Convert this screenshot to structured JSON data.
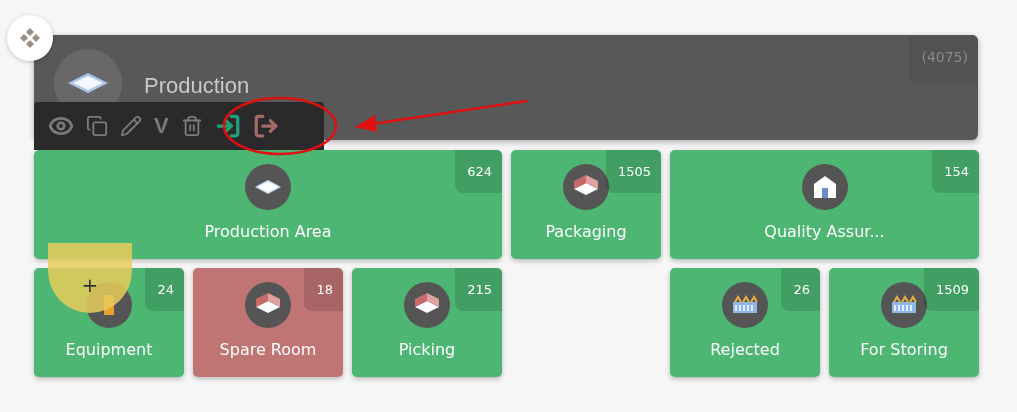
{
  "header": {
    "title": "Production",
    "count": "(4075)"
  },
  "toolbar": {
    "version_label": "V"
  },
  "add_button": {
    "label": "+"
  },
  "tiles": [
    {
      "name": "Production Area",
      "count": "624",
      "kind": "layer",
      "color": "#4cb672"
    },
    {
      "name": "Packaging",
      "count": "1505",
      "kind": "room",
      "color": "#4cb672"
    },
    {
      "name": "Quality Assur...",
      "count": "154",
      "kind": "building",
      "color": "#4cb672"
    },
    {
      "name": "Equipment",
      "count": "24",
      "kind": "equipment",
      "color": "#4cb672"
    },
    {
      "name": "Spare Room",
      "count": "18",
      "kind": "room",
      "color": "#c07474"
    },
    {
      "name": "Picking",
      "count": "215",
      "kind": "room",
      "color": "#4cb672"
    },
    {
      "name": "Rejected",
      "count": "26",
      "kind": "factory",
      "color": "#4cb672"
    },
    {
      "name": "For Storing",
      "count": "1509",
      "kind": "factory",
      "color": "#4cb672"
    }
  ]
}
